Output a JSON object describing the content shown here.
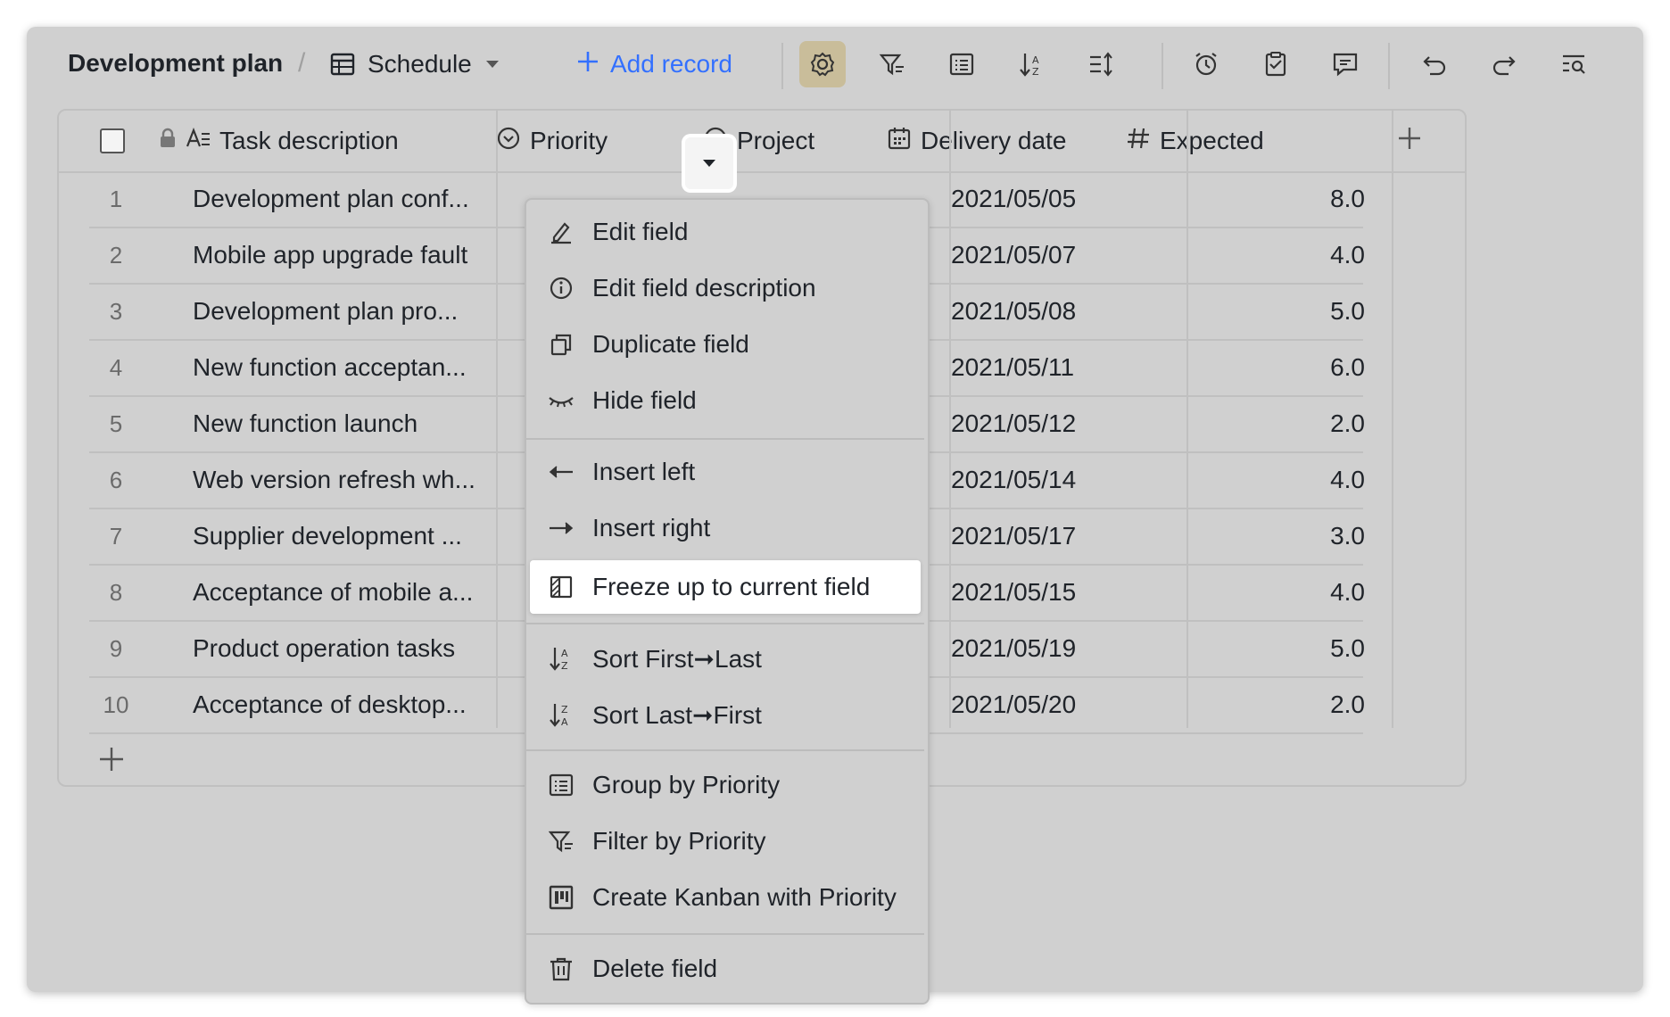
{
  "toolbar": {
    "doc_title": "Development plan",
    "separator": "/",
    "view_name": "Schedule",
    "add_record": "Add record",
    "icons": [
      "gear-icon",
      "filter-icon",
      "group-icon",
      "sort-icon",
      "row-height-icon",
      "reminder-icon",
      "form-icon",
      "comment-icon",
      "undo-icon",
      "redo-icon",
      "search-icon"
    ]
  },
  "table": {
    "headers": {
      "task": "Task description",
      "priority": "Priority",
      "project": "Project",
      "delivery": "Delivery date",
      "expected": "Expected"
    },
    "rows": [
      {
        "num": "1",
        "task": "Development plan conf...",
        "date": "2021/05/05",
        "expected": "8.0"
      },
      {
        "num": "2",
        "task": "Mobile app upgrade fault",
        "date": "2021/05/07",
        "expected": "4.0"
      },
      {
        "num": "3",
        "task": "Development plan pro...",
        "date": "2021/05/08",
        "expected": "5.0"
      },
      {
        "num": "4",
        "task": "New function acceptan...",
        "date": "2021/05/11",
        "expected": "6.0"
      },
      {
        "num": "5",
        "task": "New function launch",
        "date": "2021/05/12",
        "expected": "2.0"
      },
      {
        "num": "6",
        "task": "Web version refresh wh...",
        "date": "2021/05/14",
        "expected": "4.0"
      },
      {
        "num": "7",
        "task": "Supplier development ...",
        "date": "2021/05/17",
        "expected": "3.0"
      },
      {
        "num": "8",
        "task": "Acceptance of mobile a...",
        "date": "2021/05/15",
        "expected": "4.0"
      },
      {
        "num": "9",
        "task": "Product operation tasks",
        "date": "2021/05/19",
        "expected": "5.0"
      },
      {
        "num": "10",
        "task": "Acceptance of desktop...",
        "date": "2021/05/20",
        "expected": "2.0"
      }
    ]
  },
  "menu": {
    "items": [
      {
        "label": "Edit field",
        "icon": "pencil-icon"
      },
      {
        "label": "Edit field description",
        "icon": "info-icon"
      },
      {
        "label": "Duplicate field",
        "icon": "duplicate-icon"
      },
      {
        "label": "Hide field",
        "icon": "eye-closed-icon"
      },
      {
        "label": "Insert left",
        "icon": "arrow-left-icon"
      },
      {
        "label": "Insert right",
        "icon": "arrow-right-icon"
      },
      {
        "label": "Freeze up to current field",
        "icon": "freeze-icon"
      },
      {
        "label": "Sort First➞Last",
        "icon": "sort-asc-icon"
      },
      {
        "label": "Sort Last➞First",
        "icon": "sort-desc-icon"
      },
      {
        "label": "Group by Priority",
        "icon": "group-icon"
      },
      {
        "label": "Filter by Priority",
        "icon": "filter-icon"
      },
      {
        "label": "Create Kanban with Priority",
        "icon": "kanban-icon"
      },
      {
        "label": "Delete field",
        "icon": "trash-icon"
      }
    ],
    "highlighted": "Freeze up to current field"
  },
  "colors": {
    "accent": "#3370ff",
    "overlay": "#d0d0d0",
    "active_icon_bg": "#c9bd9a"
  }
}
